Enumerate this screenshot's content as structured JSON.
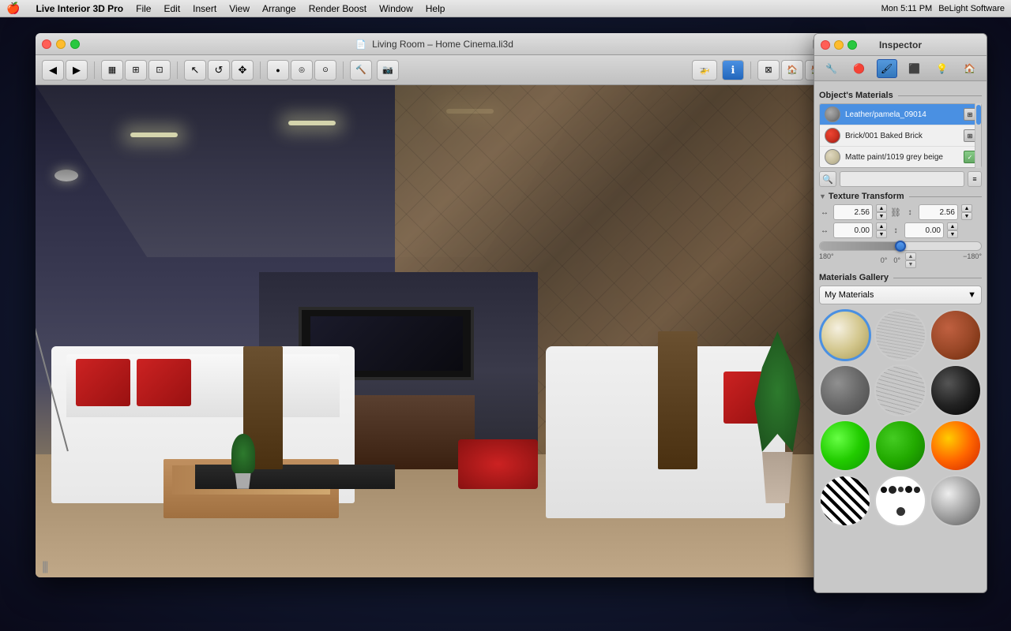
{
  "menubar": {
    "apple": "🍎",
    "app_name": "Live Interior 3D Pro",
    "menus": [
      "File",
      "Edit",
      "Insert",
      "View",
      "Arrange",
      "Render Boost",
      "Window",
      "Help"
    ],
    "right": {
      "time": "Mon 5:11 PM",
      "company": "BeLight Software"
    }
  },
  "main_window": {
    "title": "Living Room – Home Cinema.li3d",
    "traffic_lights": {
      "close": "close",
      "minimize": "minimize",
      "maximize": "maximize"
    }
  },
  "toolbar": {
    "buttons": [
      {
        "name": "back",
        "icon": "◀"
      },
      {
        "name": "forward",
        "icon": "▶"
      },
      {
        "name": "floor-plan",
        "icon": "▦"
      },
      {
        "name": "elevation",
        "icon": "⊞"
      },
      {
        "name": "perspective",
        "icon": "⊡"
      },
      {
        "name": "select",
        "icon": "↖"
      },
      {
        "name": "orbit",
        "icon": "↺"
      },
      {
        "name": "pan",
        "icon": "✥"
      },
      {
        "name": "point-light",
        "icon": "●"
      },
      {
        "name": "spot-light",
        "icon": "◎"
      },
      {
        "name": "area-light",
        "icon": "⊙"
      },
      {
        "name": "build",
        "icon": "🔨"
      },
      {
        "name": "screenshot",
        "icon": "📷"
      },
      {
        "name": "fly-through",
        "icon": "🚁"
      },
      {
        "name": "info",
        "icon": "ℹ"
      },
      {
        "name": "ortho",
        "icon": "⊠"
      },
      {
        "name": "house",
        "icon": "🏠"
      },
      {
        "name": "exterior",
        "icon": "🏠"
      }
    ]
  },
  "inspector": {
    "title": "Inspector",
    "traffic_lights": {
      "close": "close",
      "minimize": "minimize",
      "maximize": "maximize"
    },
    "tabs": [
      {
        "name": "properties",
        "icon": "🔧",
        "active": false
      },
      {
        "name": "materials",
        "icon": "🔴",
        "active": false
      },
      {
        "name": "paint",
        "icon": "🖌",
        "active": true
      },
      {
        "name": "texture",
        "icon": "⬛",
        "active": false
      },
      {
        "name": "light",
        "icon": "💡",
        "active": false
      },
      {
        "name": "object",
        "icon": "🏠",
        "active": false
      }
    ],
    "objects_materials": {
      "section_title": "Object's Materials",
      "items": [
        {
          "name": "Leather/pamela_09014",
          "swatch_color": "#888888",
          "selected": true,
          "has_icon": true
        },
        {
          "name": "Brick/001 Baked Brick",
          "swatch_color": "#cc3322",
          "selected": false,
          "has_icon": true
        },
        {
          "name": "Matte paint/1019 grey beige",
          "swatch_color": "#d4c8a8",
          "selected": false,
          "has_icon": true
        }
      ]
    },
    "texture_transform": {
      "section_title": "Texture Transform",
      "width_label": "↔",
      "height_label": "↕",
      "offset_x_label": "↔",
      "offset_y_label": "↕",
      "width_value": "2.56",
      "height_value": "2.56",
      "offset_x": "0.00",
      "offset_y": "0.00",
      "angle_value": "0°",
      "angle_min": "180°",
      "angle_mid": "0°",
      "angle_max": "−180°",
      "slider_percent": 50
    },
    "materials_gallery": {
      "section_title": "Materials Gallery",
      "dropdown_label": "My Materials",
      "items": [
        {
          "name": "cream",
          "class": "mat-cream",
          "selected": true
        },
        {
          "name": "wood",
          "class": "mat-wood",
          "selected": false
        },
        {
          "name": "brick",
          "class": "mat-brick",
          "selected": false
        },
        {
          "name": "stone",
          "class": "mat-stone",
          "selected": false
        },
        {
          "name": "dark-wood",
          "class": "mat-dark-wood",
          "selected": false
        },
        {
          "name": "black",
          "class": "mat-black",
          "selected": false
        },
        {
          "name": "green-bright",
          "class": "mat-green-bright",
          "selected": false
        },
        {
          "name": "green-dark",
          "class": "mat-green-dark",
          "selected": false
        },
        {
          "name": "fire",
          "class": "mat-fire",
          "selected": false
        },
        {
          "name": "zebra",
          "class": "mat-zebra",
          "selected": false
        },
        {
          "name": "spots",
          "class": "mat-spots",
          "selected": false
        },
        {
          "name": "silver",
          "class": "mat-silver",
          "selected": false
        }
      ]
    }
  },
  "scroll_indicator": "|||"
}
